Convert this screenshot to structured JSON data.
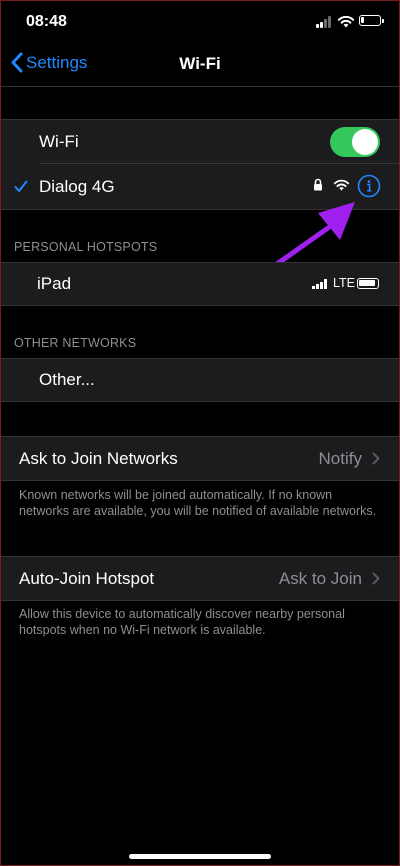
{
  "status_bar": {
    "time": "08:48",
    "battery_level": 0.2
  },
  "nav": {
    "back_label": "Settings",
    "title": "Wi-Fi"
  },
  "wifi_group": {
    "toggle_label": "Wi-Fi",
    "toggle_on": true,
    "connected_network": "Dialog 4G"
  },
  "personal_hotspots": {
    "header": "PERSONAL HOTSPOTS",
    "items": [
      {
        "name": "iPad",
        "network_type": "LTE"
      }
    ]
  },
  "other_networks": {
    "header": "OTHER NETWORKS",
    "other_label": "Other..."
  },
  "ask_to_join": {
    "label": "Ask to Join Networks",
    "value": "Notify",
    "note": "Known networks will be joined automatically. If no known networks are available, you will be notified of available networks."
  },
  "auto_join": {
    "label": "Auto-Join Hotspot",
    "value": "Ask to Join",
    "note": "Allow this device to automatically discover nearby personal hotspots when no Wi-Fi network is available."
  },
  "colors": {
    "accent": "#1e88ff",
    "toggle_on": "#34c759",
    "annotation_arrow": "#a020f0"
  },
  "icons": [
    "back-chevron-icon",
    "checkmark-icon",
    "lock-icon",
    "wifi-icon",
    "info-icon",
    "cellular-signal-icon",
    "battery-icon",
    "chevron-right-icon",
    "annotation-arrow"
  ]
}
